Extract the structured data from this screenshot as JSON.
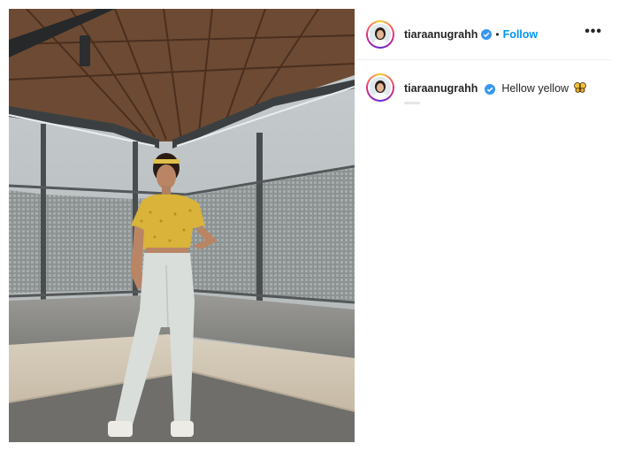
{
  "post": {
    "username": "tiaraanugrahh",
    "follow_label": "Follow",
    "separator": "•",
    "more_label": "•••",
    "caption": {
      "username": "tiaraanugrahh",
      "text": "Hellow yellow",
      "emoji": "butterfly-emoji"
    },
    "photo": {
      "subject": "woman-in-yellow-top"
    }
  },
  "colors": {
    "link_blue": "#0095f6",
    "verified_blue": "#3897f0",
    "text": "#262626",
    "divider": "#efefef"
  }
}
